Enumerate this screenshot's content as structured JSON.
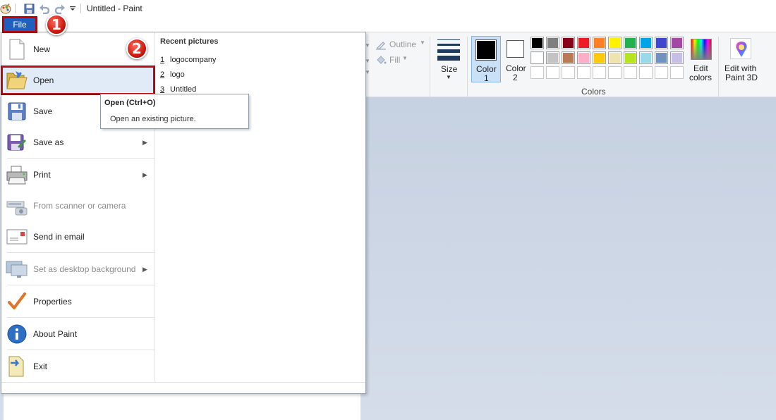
{
  "window": {
    "title": "Untitled - Paint"
  },
  "quick_access": [
    "paint-app-icon",
    "save-icon",
    "undo-icon",
    "redo-icon",
    "customize-quick-access-icon"
  ],
  "ribbon": {
    "outline_label": "Outline",
    "fill_label": "Fill",
    "size_label": "Size",
    "color1_label": "Color",
    "color1_num": "1",
    "color2_label": "Color",
    "color2_num": "2",
    "edit_colors_line1": "Edit",
    "edit_colors_line2": "colors",
    "edit_3d_line1": "Edit with",
    "edit_3d_line2": "Paint 3D",
    "colors_group_label": "Colors",
    "color1_value": "#000000",
    "color2_value": "#ffffff",
    "palette_row1": [
      "#000000",
      "#7f7f7f",
      "#880015",
      "#ed1c24",
      "#ff7f27",
      "#fff200",
      "#22b14c",
      "#00a2e8",
      "#3f48cc",
      "#a349a4"
    ],
    "palette_row2": [
      "#ffffff",
      "#c3c3c3",
      "#b97a57",
      "#ffaec9",
      "#ffc90e",
      "#efe4b0",
      "#b5e61d",
      "#99d9ea",
      "#7092be",
      "#c8bfe7"
    ],
    "palette_row3_count": "10"
  },
  "file_button": {
    "label": "File"
  },
  "badges": {
    "step1": "1",
    "step2": "2"
  },
  "file_menu": {
    "items": [
      {
        "label": "New",
        "icon": "new-document-icon",
        "enabled": true
      },
      {
        "label": "Open",
        "icon": "open-folder-icon",
        "enabled": true,
        "highlighted": true
      },
      {
        "label": "Save",
        "icon": "save-icon",
        "enabled": true
      },
      {
        "label": "Save as",
        "icon": "save-as-icon",
        "enabled": true,
        "submenu": true
      },
      {
        "label": "Print",
        "icon": "printer-icon",
        "enabled": true,
        "submenu": true
      },
      {
        "label": "From scanner or camera",
        "icon": "scanner-icon",
        "enabled": false
      },
      {
        "label": "Send in email",
        "icon": "email-icon",
        "enabled": true
      },
      {
        "label": "Set as desktop background",
        "icon": "desktop-background-icon",
        "enabled": false,
        "submenu": true
      },
      {
        "label": "Properties",
        "icon": "checkmark-icon",
        "enabled": true
      },
      {
        "label": "About Paint",
        "icon": "info-icon",
        "enabled": true
      },
      {
        "label": "Exit",
        "icon": "exit-icon",
        "enabled": true
      }
    ],
    "recent_title": "Recent pictures",
    "recent": [
      {
        "num": "1",
        "name": "logocompany"
      },
      {
        "num": "2",
        "name": "logo"
      },
      {
        "num": "3",
        "name": "Untitled"
      }
    ]
  },
  "tooltip": {
    "title": "Open (Ctrl+O)",
    "body": "Open an existing picture."
  }
}
